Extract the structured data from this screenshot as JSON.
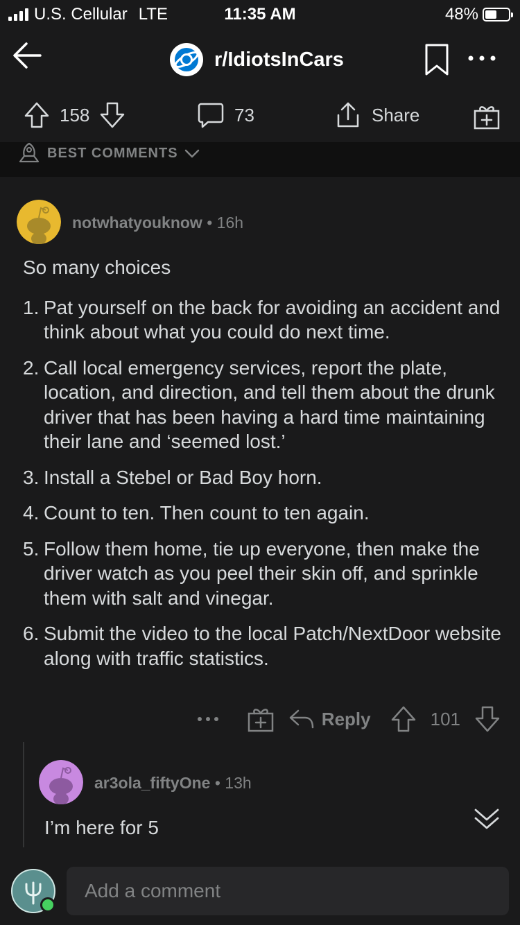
{
  "status_bar": {
    "carrier": "U.S. Cellular",
    "network": "LTE",
    "time": "11:35 AM",
    "battery": "48%",
    "battery_level": 0.48
  },
  "header": {
    "subreddit": "r/IdiotsInCars",
    "icons": [
      "back-arrow-icon",
      "subreddit-logo-icon",
      "bookmark-icon",
      "more-icon"
    ]
  },
  "actions": {
    "upvotes": "158",
    "comments": "73",
    "share": "Share",
    "icons": [
      "upvote-icon",
      "downvote-icon",
      "comment-icon",
      "share-icon",
      "award-icon"
    ]
  },
  "sort": {
    "label": "BEST COMMENTS",
    "icons": [
      "sort-rocket-icon",
      "chevron-down-icon"
    ]
  },
  "comment": {
    "username": "notwhatyouknow",
    "sep": "•",
    "age": "16h",
    "intro": "So many choices",
    "items": [
      {
        "num": "1.",
        "text": "Pat yourself on the back for avoiding an accident and think about what you could do next time."
      },
      {
        "num": "2.",
        "text": "Call local emergency services, report the plate, location, and direction, and tell them about the drunk driver that has been having a hard time maintaining their lane and ‘seemed lost.’"
      },
      {
        "num": "3.",
        "text": "Install a Stebel or Bad Boy horn."
      },
      {
        "num": "4.",
        "text": "Count to ten.  Then count to ten again."
      },
      {
        "num": "5.",
        "text": "Follow them home, tie up everyone, then make the driver watch as you peel their skin off, and sprinkle them with salt and vinegar."
      },
      {
        "num": "6.",
        "text": "Submit the video to the local Patch/NextDoor website along with traffic statistics."
      }
    ],
    "reply_label": "Reply",
    "score": "101",
    "avatar_color": "#e8b92f"
  },
  "reply": {
    "username": "ar3ola_fiftyOne",
    "sep": "•",
    "age": "13h",
    "body": "I’m here for 5",
    "avatar_color": "#c889e0"
  },
  "composer": {
    "placeholder": "Add a comment"
  },
  "colors": {
    "background": "#1a1a1b",
    "text": "#d7dadc",
    "muted": "#818384",
    "online": "#46d160"
  }
}
